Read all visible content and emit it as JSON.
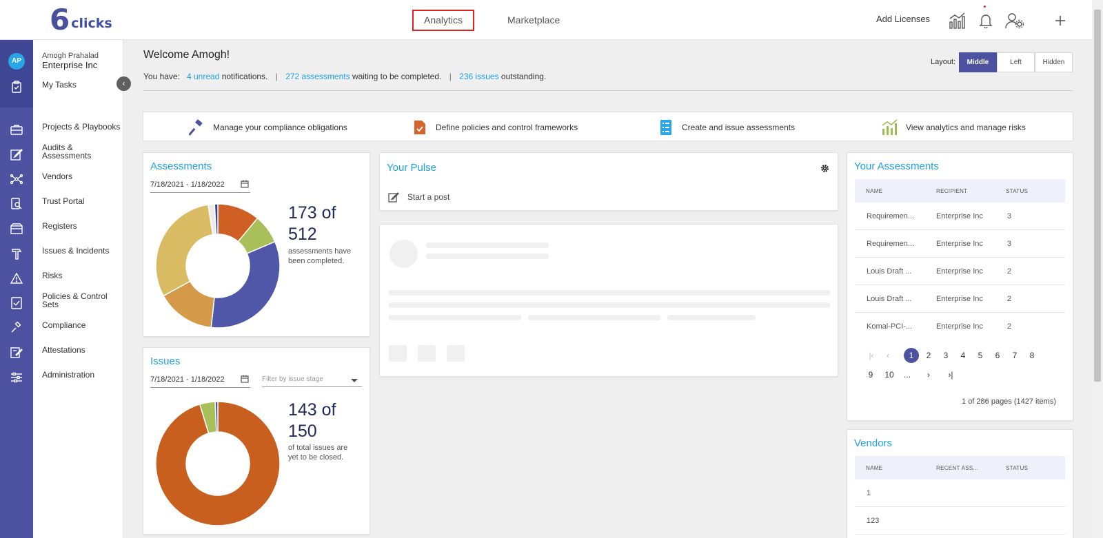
{
  "brand": {
    "mark": "6",
    "name": "clicks"
  },
  "topnav": {
    "tabs": [
      {
        "label": "Analytics"
      },
      {
        "label": "Marketplace"
      }
    ],
    "add_licenses": "Add Licenses"
  },
  "user": {
    "initials": "AP",
    "name": "Amogh Prahalad",
    "org": "Enterprise Inc"
  },
  "sidebar": {
    "my_tasks": "My Tasks",
    "items": [
      {
        "label": "Projects & Playbooks",
        "icon": "briefcase-icon"
      },
      {
        "label": "Audits & Assessments",
        "icon": "edit-icon"
      },
      {
        "label": "Vendors",
        "icon": "network-icon"
      },
      {
        "label": "Trust Portal",
        "icon": "search-doc-icon"
      },
      {
        "label": "Registers",
        "icon": "box-icon"
      },
      {
        "label": "Issues & Incidents",
        "icon": "hammer-icon"
      },
      {
        "label": "Risks",
        "icon": "warning-icon"
      },
      {
        "label": "Policies & Control Sets",
        "icon": "policy-icon"
      },
      {
        "label": "Compliance",
        "icon": "gavel-icon"
      },
      {
        "label": "Attestations",
        "icon": "sign-icon"
      },
      {
        "label": "Administration",
        "icon": "sliders-icon"
      }
    ]
  },
  "welcome": {
    "title": "Welcome Amogh!",
    "you_have": "You have:",
    "unread_link": "4 unread",
    "unread_text": "notifications.",
    "assess_link": "272 assessments",
    "assess_text": "waiting to be completed.",
    "issues_link": "236 issues",
    "issues_text": "outstanding.",
    "separator": "|"
  },
  "layout": {
    "label": "Layout:",
    "options": [
      "Middle",
      "Left",
      "Hidden"
    ],
    "selected": "Middle"
  },
  "quick_actions": [
    {
      "label": "Manage your compliance obligations",
      "icon": "gavel-icon",
      "color": "#4c52a0"
    },
    {
      "label": "Define policies and control frameworks",
      "icon": "policy-doc-icon",
      "color": "#d4662a"
    },
    {
      "label": "Create and issue assessments",
      "icon": "checklist-icon",
      "color": "#29a6e8"
    },
    {
      "label": "View analytics and manage risks",
      "icon": "analytics-chart-icon",
      "color": "#9ebd4f"
    }
  ],
  "assessments_card": {
    "title": "Assessments",
    "date_range": "7/18/2021 - 1/18/2022",
    "big_number_line1": "173 of",
    "big_number_line2": "512",
    "sub_line1": "assessments have",
    "sub_line2": "been completed."
  },
  "issues_card": {
    "title": "Issues",
    "date_range": "7/18/2021 - 1/18/2022",
    "filter_placeholder": "Filter by issue stage",
    "big_number_line1": "143 of",
    "big_number_line2": "150",
    "sub_line1": "of total issues are",
    "sub_line2": "yet to be closed."
  },
  "pulse_card": {
    "title": "Your Pulse",
    "start_post": "Start a post"
  },
  "your_assessments": {
    "title": "Your Assessments",
    "columns": [
      "NAME",
      "RECIPIENT",
      "STATUS"
    ],
    "rows": [
      [
        "Requiremen...",
        "Enterprise Inc",
        "3"
      ],
      [
        "Requiremen...",
        "Enterprise Inc",
        "3"
      ],
      [
        "Louis Draft ...",
        "Enterprise Inc",
        "2"
      ],
      [
        "Louis Draft ...",
        "Enterprise Inc",
        "2"
      ],
      [
        "Komal-PCI-...",
        "Enterprise Inc",
        "2"
      ]
    ],
    "pager": {
      "first": "|‹",
      "prev": "‹",
      "next": "›",
      "last": "›|",
      "pages": [
        "1",
        "2",
        "3",
        "4",
        "5",
        "6",
        "7",
        "8",
        "9",
        "10",
        "..."
      ],
      "current": "1",
      "info": "1 of 286 pages (1427 items)"
    }
  },
  "vendors_card": {
    "title": "Vendors",
    "columns": [
      "NAME",
      "RECENT ASS...",
      "STATUS"
    ],
    "rows": [
      [
        "1",
        "",
        ""
      ],
      [
        "123",
        "",
        ""
      ]
    ]
  },
  "chart_data": [
    {
      "type": "pie",
      "title": "Assessments",
      "donut": true,
      "categories": [
        "seg-1",
        "seg-2",
        "seg-3",
        "seg-4",
        "seg-5",
        "seg-6",
        "seg-7"
      ],
      "values": [
        10.5,
        7.2,
        31.5,
        14.5,
        29,
        1.6,
        0.8
      ],
      "colors": [
        "#cf5f22",
        "#a9c05a",
        "#5057a8",
        "#d49a4a",
        "#d8bb62",
        "#ebebeb",
        "#3a3f90"
      ]
    },
    {
      "type": "pie",
      "title": "Issues",
      "donut": true,
      "categories": [
        "seg-1",
        "seg-2",
        "seg-3"
      ],
      "values": [
        95.3,
        4.0,
        0.7
      ],
      "colors": [
        "#c85f1f",
        "#a9c05a",
        "#4c52a0"
      ]
    }
  ]
}
